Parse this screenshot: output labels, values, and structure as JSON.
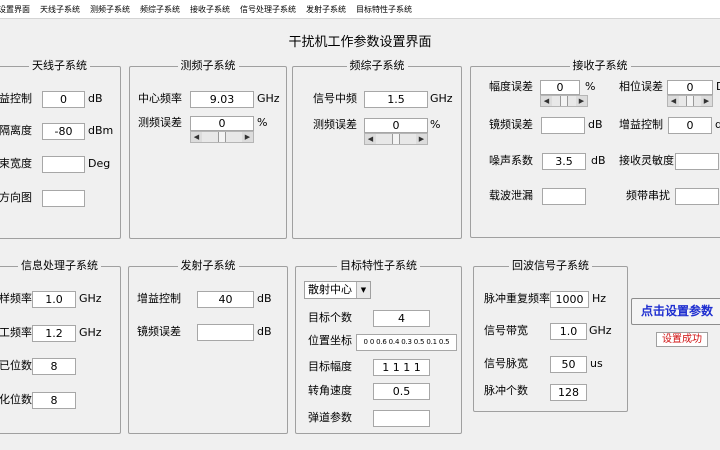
{
  "menu": [
    "设置界面",
    "天线子系统",
    "测频子系统",
    "频综子系统",
    "接收子系统",
    "信号处理子系统",
    "发射子系统",
    "目标特性子系统"
  ],
  "title": "干扰机工作参数设置界面",
  "antenna": {
    "title": "天线子系统",
    "gain_label": "益控制",
    "gain_value": "0",
    "gain_unit": "dB",
    "sidelobe_label": "隔离度",
    "sidelobe_value": "-80",
    "sidelobe_unit": "dBm",
    "beam_label": "束宽度",
    "beam_value": "",
    "beam_unit": "Deg",
    "pattern_label": "方向图",
    "pattern_value": ""
  },
  "freqmeas": {
    "title": "测频子系统",
    "center_label": "中心频率",
    "center_value": "9.03",
    "center_unit": "GHz",
    "error_label": "测频误差",
    "error_value": "0",
    "error_unit": "%"
  },
  "synth": {
    "title": "频综子系统",
    "if_label": "信号中频",
    "if_value": "1.5",
    "if_unit": "GHz",
    "error_label": "测频误差",
    "error_value": "0",
    "error_unit": "%"
  },
  "receiver": {
    "title": "接收子系统",
    "amp_label": "幅度误差",
    "amp_value": "0",
    "amp_unit": "%",
    "phase_label": "相位误差",
    "phase_value": "0",
    "phase_unit": "D",
    "image_label": "镜频误差",
    "image_value": "",
    "image_unit": "dB",
    "gain_label": "增益控制",
    "gain_value": "0",
    "gain_unit": "d",
    "noise_label": "噪声系数",
    "noise_value": "3.5",
    "noise_unit": "dB",
    "sens_label": "接收灵敏度",
    "sens_value": "",
    "leak_label": "载波泄漏",
    "leak_value": "",
    "cross_label": "频带串扰",
    "cross_value": ""
  },
  "sigproc": {
    "title": "信息处理子系统",
    "f1_label": "样频率",
    "f1_value": "1.0",
    "f1_unit": "GHz",
    "f2_label": "工频率",
    "f2_value": "1.2",
    "f2_unit": "GHz",
    "b1_label": "已位数",
    "b1_value": "8",
    "b2_label": "化位数",
    "b2_value": "8"
  },
  "transmit": {
    "title": "发射子系统",
    "gain_label": "增益控制",
    "gain_value": "40",
    "gain_unit": "dB",
    "image_label": "镜频误差",
    "image_value": "",
    "image_unit": "dB"
  },
  "target": {
    "title": "目标特性子系统",
    "mode_value": "散射中心",
    "count_label": "目标个数",
    "count_value": "4",
    "pos_label": "位置坐标",
    "pos_value": "0 0 0.6 0.4 0.3 0.5 0.1 0.5",
    "amp_label": "目标幅度",
    "amp_value": "1 1 1 1",
    "speed_label": "转角速度",
    "speed_value": "0.5",
    "ballistic_label": "弹道参数",
    "ballistic_value": ""
  },
  "echo": {
    "title": "回波信号子系统",
    "prf_label": "脉冲重复频率",
    "prf_value": "1000",
    "prf_unit": "Hz",
    "bw_label": "信号带宽",
    "bw_value": "1.0",
    "bw_unit": "GHz",
    "pw_label": "信号脉宽",
    "pw_value": "50",
    "pw_unit": "us",
    "np_label": "脉冲个数",
    "np_value": "128"
  },
  "actions": {
    "set_button": "点击设置参数",
    "status": "设置成功"
  }
}
